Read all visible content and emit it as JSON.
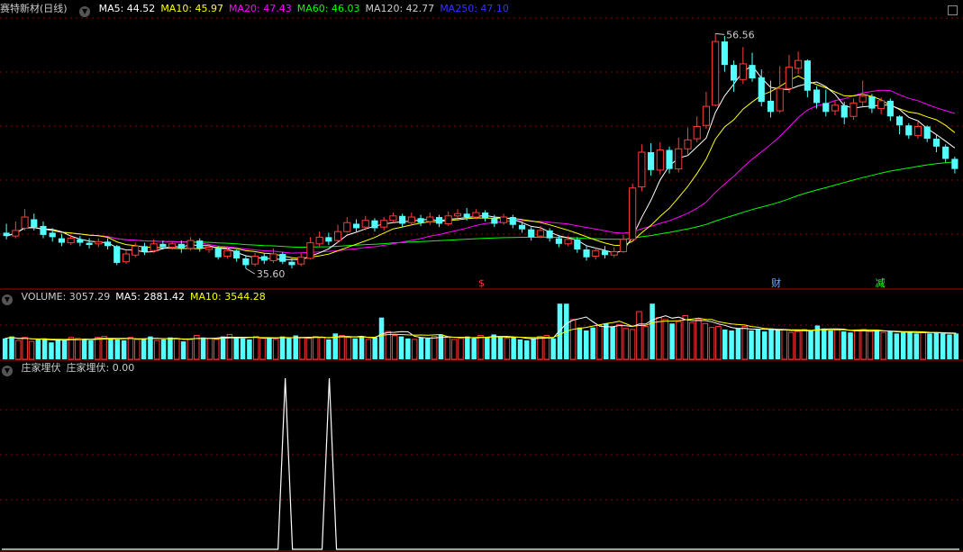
{
  "stock": {
    "name": "赛特新材",
    "period": "(日线)"
  },
  "ma_legend": [
    {
      "label": "MA5: 44.52",
      "color": "#ffffff"
    },
    {
      "label": "MA10: 45.97",
      "color": "#ffff00"
    },
    {
      "label": "MA20: 47.43",
      "color": "#ff00ff"
    },
    {
      "label": "MA60: 46.03",
      "color": "#00ff00"
    },
    {
      "label": "MA120: 42.77",
      "color": "#cccccc"
    },
    {
      "label": "MA250: 47.10",
      "color": "#3333ff"
    }
  ],
  "volume_legend": [
    {
      "label": "VOLUME: 3057.29",
      "color": "#cccccc"
    },
    {
      "label": "MA5: 2881.42",
      "color": "#ffffff"
    },
    {
      "label": "MA10: 3544.28",
      "color": "#ffff00"
    }
  ],
  "indicator_legend": [
    {
      "label": "庄家埋伏",
      "color": "#cccccc"
    },
    {
      "label": "庄家埋伏: 0.00",
      "color": "#cccccc"
    }
  ],
  "markers": [
    {
      "text": "$",
      "color": "#ff3333"
    },
    {
      "text": "财",
      "color": "#6fa8ff"
    },
    {
      "text": "减",
      "color": "#33ff33"
    }
  ],
  "colors": {
    "up": "#ff3b3b",
    "down": "#54ffff",
    "grid": "#8b0000",
    "frame": "#b00000"
  },
  "chart_data": [
    {
      "type": "candlestick",
      "title": "赛特新材(日线)",
      "price_high_label": "56.56",
      "price_low_label": "35.60",
      "ylim": [
        34,
        58
      ],
      "candles": [
        [
          38.8,
          38.5,
          39.6,
          38.2
        ],
        [
          38.5,
          39.0,
          39.8,
          38.3
        ],
        [
          39.2,
          40.2,
          40.9,
          39.0
        ],
        [
          40.0,
          39.3,
          40.5,
          39.0
        ],
        [
          39.4,
          38.6,
          39.8,
          38.3
        ],
        [
          38.8,
          38.4,
          39.2,
          38.0
        ],
        [
          38.3,
          37.9,
          38.7,
          37.6
        ],
        [
          37.9,
          38.3,
          38.6,
          37.7
        ],
        [
          38.2,
          37.9,
          38.5,
          37.6
        ],
        [
          37.9,
          37.7,
          38.3,
          37.4
        ],
        [
          37.8,
          38.0,
          38.3,
          37.5
        ],
        [
          38.0,
          37.6,
          38.3,
          37.3
        ],
        [
          37.6,
          36.1,
          37.7,
          35.9
        ],
        [
          36.2,
          36.9,
          37.2,
          36.0
        ],
        [
          36.8,
          37.6,
          37.9,
          36.6
        ],
        [
          37.6,
          37.1,
          37.9,
          36.8
        ],
        [
          37.2,
          37.8,
          38.2,
          37.0
        ],
        [
          37.8,
          37.5,
          38.1,
          37.3
        ],
        [
          37.5,
          37.8,
          38.0,
          37.3
        ],
        [
          37.8,
          37.4,
          38.1,
          37.0
        ],
        [
          37.4,
          38.1,
          38.4,
          37.2
        ],
        [
          38.1,
          37.4,
          38.3,
          37.1
        ],
        [
          37.3,
          37.5,
          37.8,
          37.0
        ],
        [
          37.4,
          36.6,
          37.6,
          36.4
        ],
        [
          36.7,
          37.2,
          37.5,
          36.5
        ],
        [
          37.2,
          36.5,
          37.3,
          36.2
        ],
        [
          36.5,
          35.9,
          36.7,
          35.6
        ],
        [
          36.0,
          36.7,
          37.0,
          35.8
        ],
        [
          36.7,
          36.3,
          37.0,
          36.0
        ],
        [
          36.3,
          36.9,
          37.4,
          36.1
        ],
        [
          36.9,
          36.2,
          37.1,
          36.0
        ],
        [
          36.2,
          35.9,
          36.5,
          35.6
        ],
        [
          36.0,
          36.6,
          37.0,
          35.8
        ],
        [
          36.5,
          37.9,
          38.4,
          36.4
        ],
        [
          37.8,
          38.4,
          38.9,
          37.6
        ],
        [
          38.4,
          38.0,
          38.8,
          37.7
        ],
        [
          38.1,
          38.9,
          39.5,
          37.9
        ],
        [
          38.9,
          39.7,
          40.2,
          38.8
        ],
        [
          39.6,
          39.2,
          40.0,
          38.9
        ],
        [
          39.3,
          39.9,
          40.3,
          39.0
        ],
        [
          39.9,
          39.2,
          40.1,
          38.9
        ],
        [
          39.3,
          39.9,
          40.2,
          39.0
        ],
        [
          39.9,
          40.3,
          40.6,
          39.7
        ],
        [
          40.3,
          39.6,
          40.5,
          39.3
        ],
        [
          39.7,
          40.2,
          40.6,
          39.5
        ],
        [
          40.1,
          39.7,
          40.4,
          39.4
        ],
        [
          39.8,
          40.2,
          40.6,
          39.5
        ],
        [
          40.2,
          39.6,
          40.4,
          39.3
        ],
        [
          39.6,
          40.3,
          40.7,
          39.4
        ],
        [
          40.3,
          40.5,
          40.9,
          40.1
        ],
        [
          40.5,
          40.2,
          41.0,
          39.9
        ],
        [
          40.2,
          40.6,
          40.9,
          40.0
        ],
        [
          40.6,
          40.1,
          40.8,
          39.8
        ],
        [
          40.1,
          39.6,
          40.4,
          39.3
        ],
        [
          39.7,
          40.2,
          40.5,
          39.5
        ],
        [
          40.2,
          39.5,
          40.4,
          39.2
        ],
        [
          39.5,
          39.1,
          39.8,
          38.8
        ],
        [
          39.1,
          38.4,
          39.3,
          38.1
        ],
        [
          38.5,
          39.0,
          39.4,
          38.3
        ],
        [
          39.0,
          38.3,
          39.2,
          38.0
        ],
        [
          38.3,
          37.8,
          38.6,
          37.5
        ],
        [
          37.8,
          38.2,
          38.5,
          37.6
        ],
        [
          38.2,
          37.3,
          38.4,
          37.0
        ],
        [
          37.3,
          36.6,
          37.6,
          36.3
        ],
        [
          36.7,
          37.2,
          37.5,
          36.4
        ],
        [
          37.2,
          36.8,
          37.6,
          36.5
        ],
        [
          36.8,
          37.1,
          37.5,
          36.6
        ],
        [
          37.1,
          38.2,
          38.6,
          37.0
        ],
        [
          38.2,
          42.8,
          43.2,
          38.2
        ],
        [
          42.9,
          46.0,
          46.7,
          42.5
        ],
        [
          46.0,
          44.4,
          46.8,
          43.9
        ],
        [
          44.4,
          46.2,
          46.9,
          44.0
        ],
        [
          46.2,
          44.5,
          46.5,
          44.1
        ],
        [
          44.5,
          46.3,
          47.3,
          44.2
        ],
        [
          46.3,
          47.1,
          48.2,
          45.8
        ],
        [
          47.2,
          48.3,
          49.2,
          46.9
        ],
        [
          48.4,
          50.1,
          51.4,
          48.1
        ],
        [
          50.2,
          55.9,
          56.6,
          50.1
        ],
        [
          55.9,
          53.8,
          56.4,
          53.2
        ],
        [
          53.8,
          52.4,
          54.2,
          51.4
        ],
        [
          52.5,
          53.9,
          55.4,
          52.1
        ],
        [
          53.8,
          52.6,
          54.9,
          52.3
        ],
        [
          52.7,
          50.5,
          53.4,
          50.1
        ],
        [
          50.6,
          49.6,
          52.4,
          49.1
        ],
        [
          49.7,
          51.7,
          53.7,
          49.5
        ],
        [
          51.7,
          53.6,
          54.7,
          51.3
        ],
        [
          53.5,
          54.2,
          55.0,
          53.0
        ],
        [
          54.2,
          51.5,
          54.3,
          50.9
        ],
        [
          51.6,
          50.4,
          51.9,
          49.9
        ],
        [
          50.4,
          49.6,
          51.6,
          49.2
        ],
        [
          49.7,
          50.2,
          50.6,
          49.3
        ],
        [
          50.2,
          49.1,
          50.5,
          48.5
        ],
        [
          49.2,
          50.4,
          50.8,
          48.9
        ],
        [
          50.5,
          51.0,
          52.4,
          50.1
        ],
        [
          51.0,
          49.9,
          51.2,
          49.5
        ],
        [
          49.9,
          50.6,
          50.9,
          49.4
        ],
        [
          50.6,
          49.2,
          50.8,
          48.8
        ],
        [
          49.2,
          48.4,
          49.3,
          47.6
        ],
        [
          48.4,
          47.5,
          48.6,
          47.2
        ],
        [
          47.5,
          48.3,
          48.7,
          47.2
        ],
        [
          48.3,
          47.2,
          48.4,
          46.9
        ],
        [
          47.2,
          46.5,
          47.6,
          46.0
        ],
        [
          46.5,
          45.4,
          46.7,
          45.1
        ],
        [
          45.4,
          44.5,
          45.6,
          44.1
        ]
      ]
    },
    {
      "type": "bar",
      "title": "VOLUME",
      "ylim": [
        0,
        5800
      ],
      "values": [
        2100,
        2300,
        1900,
        2200,
        1800,
        2000,
        2100,
        1700,
        2000,
        1900,
        2200,
        2100,
        2000,
        1900,
        2200,
        2300,
        2100,
        2000,
        1900,
        2200,
        2000,
        2100,
        2300,
        1900,
        2000,
        2200,
        2100,
        1800,
        2000,
        2400,
        2200,
        2100,
        2000,
        2300,
        2500,
        2200,
        2100,
        2000,
        2300,
        2100,
        2200,
        2000,
        2300,
        2100,
        2400,
        2200,
        2100,
        2300,
        2200,
        2000,
        2600,
        2400,
        2200,
        2100,
        2300,
        2000,
        2200,
        4200,
        2800,
        2400,
        2300,
        2100,
        2000,
        2200,
        2100,
        2300,
        2500,
        2200,
        2000,
        2100,
        2300,
        2100,
        2400,
        2200,
        2500,
        2300,
        2100,
        2200,
        2000,
        1900,
        2100,
        2300,
        2400,
        2100,
        5600,
        5600,
        4000,
        3200,
        2900,
        3200,
        3400,
        3600,
        3300,
        3500,
        3100,
        3000,
        4800,
        3300,
        5600,
        4200,
        4000,
        3600,
        3800,
        4400,
        3700,
        4000,
        3600,
        3200,
        3300,
        3000,
        2900,
        3100,
        3300,
        2900,
        3000,
        2800,
        3100,
        2900,
        3000,
        2700,
        2800,
        3000,
        2900,
        3400,
        3100,
        2900,
        3000,
        2800,
        2700,
        2900,
        3000,
        2800,
        2900,
        2700,
        2800,
        2600,
        2700,
        2800,
        2600,
        2700,
        2600,
        2700,
        2600,
        2500,
        2600
      ]
    },
    {
      "type": "line",
      "title": "庄家埋伏",
      "ylim": [
        0,
        1
      ],
      "peak_positions": [
        0.296,
        0.342
      ],
      "peak_value": 1
    }
  ]
}
